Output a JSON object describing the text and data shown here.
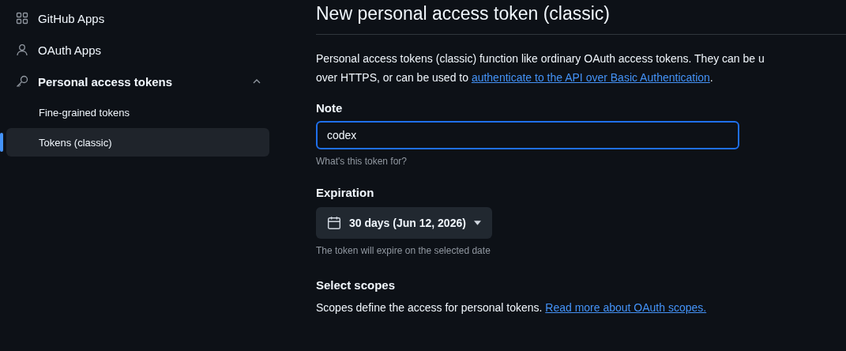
{
  "sidebar": {
    "items": [
      {
        "label": "GitHub Apps",
        "kind": "apps",
        "selected": false
      },
      {
        "label": "OAuth Apps",
        "kind": "person",
        "selected": false
      },
      {
        "label": "Personal access tokens",
        "kind": "key",
        "selected": false,
        "expanded": true,
        "children": [
          {
            "label": "Fine-grained tokens",
            "selected": false
          },
          {
            "label": "Tokens (classic)",
            "selected": true
          }
        ]
      }
    ]
  },
  "page_title": "New personal access token (classic)",
  "intro": {
    "line_1": "Personal access tokens (classic) function like ordinary OAuth access tokens. They can be u",
    "line_2": "over HTTPS, or can be used to",
    "link": "authenticate to the API over Basic Authentication",
    "end": "."
  },
  "note": {
    "label": "Note",
    "value": "codex",
    "hint": "What's this token for?"
  },
  "expiration": {
    "label": "Expiration",
    "value": "30 days (Jun 12, 2026)",
    "hint": "The token will expire on the selected date"
  },
  "scopes": {
    "label": "Select scopes",
    "text": "Scopes define the access for personal tokens.",
    "link": "Read more about OAuth scopes."
  }
}
